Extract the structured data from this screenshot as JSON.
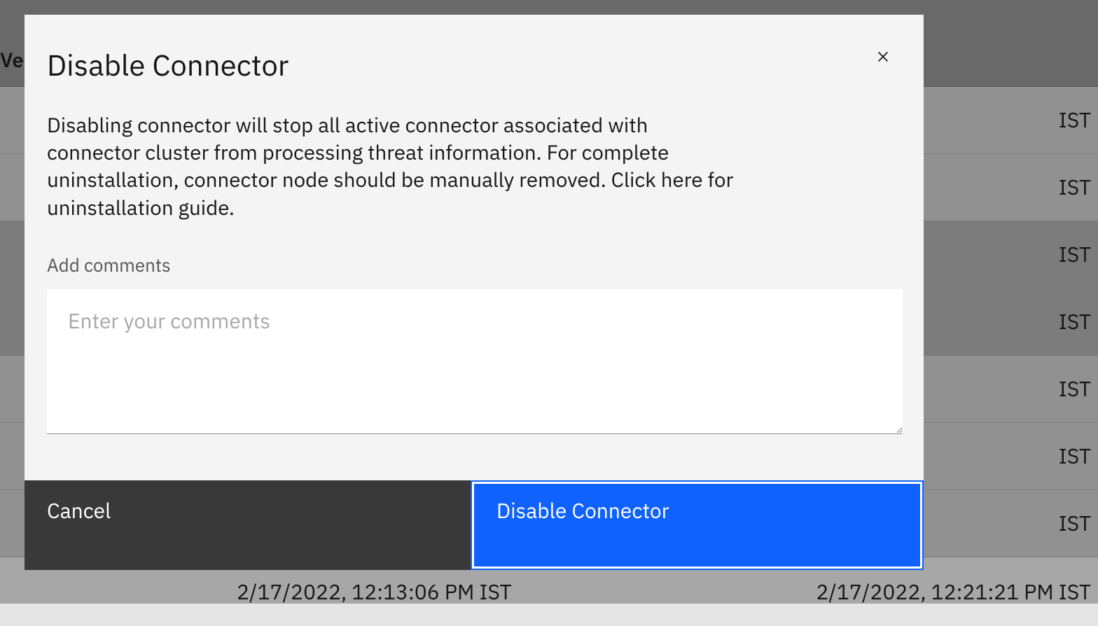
{
  "background": {
    "header_fragment": "Ve",
    "rows": [
      {
        "right_fragment": "IST"
      },
      {
        "right_fragment": "IST"
      },
      {
        "right_fragment": "IST"
      },
      {
        "right_fragment": "IST"
      },
      {
        "right_fragment": "IST"
      },
      {
        "right_fragment": "IST"
      },
      {
        "right_fragment": "IST"
      }
    ],
    "full_row": {
      "left": "2/17/2022, 12:13:06 PM IST",
      "right": "2/17/2022, 12:21:21 PM IST"
    }
  },
  "modal": {
    "title": "Disable Connector",
    "description": "Disabling connector will stop all active connector associated with connector cluster from processing threat information. For complete uninstallation, connector node should be manually removed. Click here for uninstallation guide.",
    "comments_label": "Add comments",
    "comments_placeholder": "Enter your comments",
    "cancel_label": "Cancel",
    "confirm_label": "Disable Connector"
  }
}
